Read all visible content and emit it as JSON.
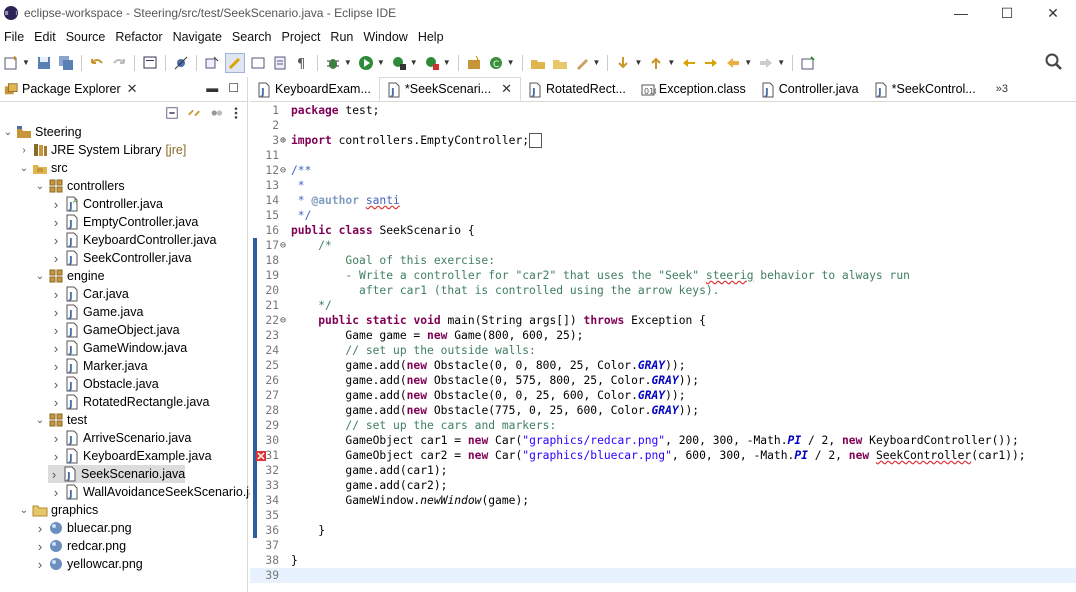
{
  "window": {
    "title": "eclipse-workspace - Steering/src/test/SeekScenario.java - Eclipse IDE",
    "minimize": "—",
    "maximize": "☐",
    "close": "✕"
  },
  "menu": [
    "File",
    "Edit",
    "Source",
    "Refactor",
    "Navigate",
    "Search",
    "Project",
    "Run",
    "Window",
    "Help"
  ],
  "package_explorer": {
    "title": "Package Explorer",
    "tree": [
      {
        "label": "Steering",
        "depth": 0,
        "expanded": true,
        "icon": "project-icon"
      },
      {
        "label": "JRE System Library",
        "suffix": "[jre]",
        "depth": 1,
        "expanded": false,
        "icon": "library-icon"
      },
      {
        "label": "src",
        "depth": 1,
        "expanded": true,
        "icon": "source-folder-icon"
      },
      {
        "label": "controllers",
        "depth": 2,
        "expanded": true,
        "icon": "package-icon"
      },
      {
        "label": "Controller.java",
        "depth": 3,
        "icon": "java-abstract-file-icon"
      },
      {
        "label": "EmptyController.java",
        "depth": 3,
        "icon": "java-file-icon"
      },
      {
        "label": "KeyboardController.java",
        "depth": 3,
        "icon": "java-file-icon"
      },
      {
        "label": "SeekController.java",
        "depth": 3,
        "icon": "java-file-icon"
      },
      {
        "label": "engine",
        "depth": 2,
        "expanded": true,
        "icon": "package-icon"
      },
      {
        "label": "Car.java",
        "depth": 3,
        "icon": "java-file-icon"
      },
      {
        "label": "Game.java",
        "depth": 3,
        "icon": "java-file-icon"
      },
      {
        "label": "GameObject.java",
        "depth": 3,
        "icon": "java-file-icon"
      },
      {
        "label": "GameWindow.java",
        "depth": 3,
        "icon": "java-file-icon"
      },
      {
        "label": "Marker.java",
        "depth": 3,
        "icon": "java-file-icon"
      },
      {
        "label": "Obstacle.java",
        "depth": 3,
        "icon": "java-file-icon"
      },
      {
        "label": "RotatedRectangle.java",
        "depth": 3,
        "icon": "java-file-icon"
      },
      {
        "label": "test",
        "depth": 2,
        "expanded": true,
        "icon": "package-icon"
      },
      {
        "label": "ArriveScenario.java",
        "depth": 3,
        "icon": "java-file-icon"
      },
      {
        "label": "KeyboardExample.java",
        "depth": 3,
        "icon": "java-file-icon"
      },
      {
        "label": "SeekScenario.java",
        "depth": 3,
        "icon": "java-file-icon",
        "selected": true
      },
      {
        "label": "WallAvoidanceSeekScenario.java",
        "depth": 3,
        "icon": "java-file-icon"
      },
      {
        "label": "graphics",
        "depth": 1,
        "expanded": true,
        "icon": "folder-icon"
      },
      {
        "label": "bluecar.png",
        "depth": 2,
        "icon": "image-file-icon"
      },
      {
        "label": "redcar.png",
        "depth": 2,
        "icon": "image-file-icon"
      },
      {
        "label": "yellowcar.png",
        "depth": 2,
        "icon": "image-file-icon"
      }
    ]
  },
  "editor_tabs": [
    {
      "label": "KeyboardExam...",
      "icon": "java-file-icon",
      "active": false
    },
    {
      "label": "*SeekScenari...",
      "icon": "java-file-icon",
      "active": true,
      "closable": true
    },
    {
      "label": "RotatedRect...",
      "icon": "java-file-icon",
      "active": false
    },
    {
      "label": "Exception.class",
      "icon": "class-file-icon",
      "active": false
    },
    {
      "label": "Controller.java",
      "icon": "java-file-icon",
      "active": false
    },
    {
      "label": "*SeekControl...",
      "icon": "java-file-icon",
      "active": false
    }
  ],
  "overflow_label": "»3",
  "code_lines": [
    {
      "n": "1",
      "html": "<span class='kw'>package</span> test;"
    },
    {
      "n": "2",
      "html": ""
    },
    {
      "n": "3",
      "fold": "⊕",
      "html": "<span class='kw'>import</span> controllers.EmptyController;<span style='border:1px solid #555;padding:0 2px;'>&nbsp;</span>"
    },
    {
      "n": "11",
      "html": ""
    },
    {
      "n": "12",
      "fold": "⊖",
      "html": "<span class='jd'>/**</span>"
    },
    {
      "n": "13",
      "html": "<span class='jd'> *</span>"
    },
    {
      "n": "14",
      "html": "<span class='jd'> * <b style='color:#7f9fbf'>@author</b> <span class='sq'>santi</span></span>"
    },
    {
      "n": "15",
      "html": "<span class='jd'> */</span>"
    },
    {
      "n": "16",
      "html": "<span class='kw'>public</span> <span class='kw'>class</span> SeekScenario {"
    },
    {
      "n": "17",
      "fold": "⊖",
      "ruler": true,
      "html": "    <span class='cm'>/*</span>"
    },
    {
      "n": "18",
      "ruler": true,
      "html": "<span class='cm'>        Goal of this exercise:</span>"
    },
    {
      "n": "19",
      "ruler": true,
      "html": "<span class='cm'>        - Write a controller for \"car2\" that uses the \"Seek\" <span class='sq'>steerig</span> behavior to always run</span>"
    },
    {
      "n": "20",
      "ruler": true,
      "html": "<span class='cm'>          after car1 (that is controlled using the arrow keys).</span>"
    },
    {
      "n": "21",
      "ruler": true,
      "html": "<span class='cm'>    */</span>"
    },
    {
      "n": "22",
      "fold": "⊖",
      "ruler": true,
      "html": "    <span class='kw'>public</span> <span class='kw'>static</span> <span class='kw'>void</span> main(String args[]) <span class='kw'>throws</span> Exception {"
    },
    {
      "n": "23",
      "ruler": true,
      "html": "        Game game = <span class='kw'>new</span> Game(800, 600, 25);"
    },
    {
      "n": "24",
      "ruler": true,
      "html": "        <span class='cm'>// set up the outside walls:</span>"
    },
    {
      "n": "25",
      "ruler": true,
      "html": "        game.add(<span class='kw'>new</span> Obstacle(0, 0, 800, 25, Color.<span class='sf'>GRAY</span>));"
    },
    {
      "n": "26",
      "ruler": true,
      "html": "        game.add(<span class='kw'>new</span> Obstacle(0, 575, 800, 25, Color.<span class='sf'>GRAY</span>));"
    },
    {
      "n": "27",
      "ruler": true,
      "html": "        game.add(<span class='kw'>new</span> Obstacle(0, 0, 25, 600, Color.<span class='sf'>GRAY</span>));"
    },
    {
      "n": "28",
      "ruler": true,
      "html": "        game.add(<span class='kw'>new</span> Obstacle(775, 0, 25, 600, Color.<span class='sf'>GRAY</span>));"
    },
    {
      "n": "29",
      "ruler": true,
      "html": "        <span class='cm'>// set up the cars and markers:</span>"
    },
    {
      "n": "30",
      "ruler": true,
      "html": "        GameObject car1 = <span class='kw'>new</span> Car(<span class='st'>\"graphics/redcar.png\"</span>, 200, 300, -Math.<span class='sf'>PI</span> / 2, <span class='kw'>new</span> KeyboardController());"
    },
    {
      "n": "31",
      "ruler": true,
      "error": true,
      "html": "        GameObject car2 = <span class='kw'>new</span> Car(<span class='st'>\"graphics/bluecar.png\"</span>, 600, 300, -Math.<span class='sf'>PI</span> / 2, <span class='kw'>new</span> <span class='sq'>SeekController</span>(car1));"
    },
    {
      "n": "32",
      "ruler": true,
      "html": "        game.add(car1);"
    },
    {
      "n": "33",
      "ruler": true,
      "html": "        game.add(car2);"
    },
    {
      "n": "34",
      "ruler": true,
      "html": "        GameWindow.<span class='it'>newWindow</span>(game);"
    },
    {
      "n": "35",
      "ruler": true,
      "html": ""
    },
    {
      "n": "36",
      "ruler": true,
      "html": "    }"
    },
    {
      "n": "37",
      "html": ""
    },
    {
      "n": "38",
      "html": "}"
    },
    {
      "n": "39",
      "html": "",
      "highlight": true
    }
  ]
}
